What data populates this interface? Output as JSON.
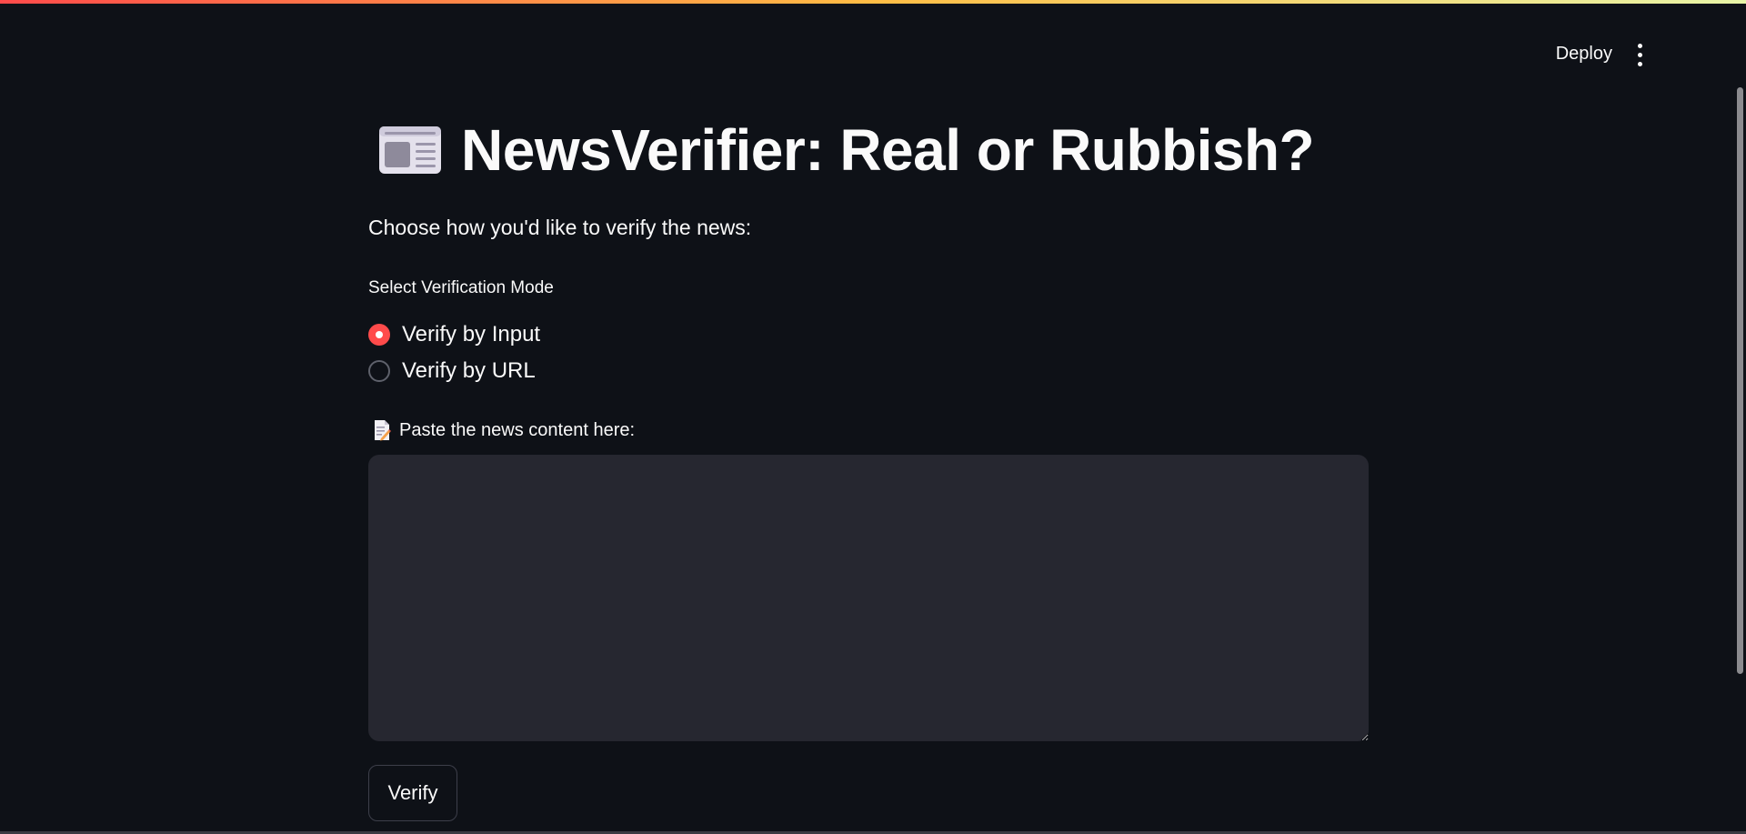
{
  "header": {
    "deploy_label": "Deploy",
    "menu_icon": "vertical-ellipsis-icon"
  },
  "main": {
    "title_icon": "newspaper-icon",
    "title": "NewsVerifier: Real or Rubbish?",
    "subtitle": "Choose how you'd like to verify the news:",
    "mode_label": "Select Verification Mode",
    "modes": [
      {
        "label": "Verify by Input",
        "selected": true
      },
      {
        "label": "Verify by URL",
        "selected": false
      }
    ],
    "content_label_icon": "memo-icon",
    "content_label": "Paste the news content here:",
    "content_value": "",
    "verify_label": "Verify"
  },
  "colors": {
    "background": "#0e1117",
    "accent": "#ff4b4b",
    "input_background": "#262730",
    "text": "#fafafa"
  }
}
